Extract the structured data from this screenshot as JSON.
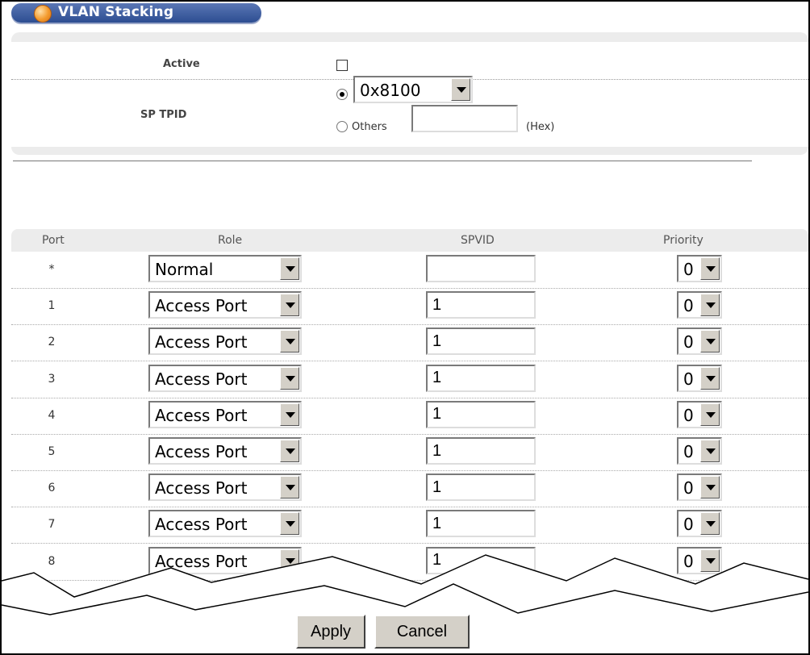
{
  "title": "VLAN Stacking",
  "settings": {
    "active_label": "Active",
    "active_checked": false,
    "sp_tpid_label": "SP TPID",
    "tpid_selected": "0x8100",
    "others_label": "Others",
    "others_value": "",
    "hex_label": "(Hex)"
  },
  "table": {
    "headers": {
      "port": "Port",
      "role": "Role",
      "spvid": "SPVID",
      "priority": "Priority"
    },
    "rows": [
      {
        "port": "*",
        "role": "Normal",
        "spvid": "",
        "priority": "0"
      },
      {
        "port": "1",
        "role": "Access Port",
        "spvid": "1",
        "priority": "0"
      },
      {
        "port": "2",
        "role": "Access Port",
        "spvid": "1",
        "priority": "0"
      },
      {
        "port": "3",
        "role": "Access Port",
        "spvid": "1",
        "priority": "0"
      },
      {
        "port": "4",
        "role": "Access Port",
        "spvid": "1",
        "priority": "0"
      },
      {
        "port": "5",
        "role": "Access Port",
        "spvid": "1",
        "priority": "0"
      },
      {
        "port": "6",
        "role": "Access Port",
        "spvid": "1",
        "priority": "0"
      },
      {
        "port": "7",
        "role": "Access Port",
        "spvid": "1",
        "priority": "0"
      },
      {
        "port": "8",
        "role": "Access Port",
        "spvid": "1",
        "priority": "0"
      }
    ]
  },
  "buttons": {
    "apply": "Apply",
    "cancel": "Cancel"
  },
  "colors": {
    "title_bar": "#2c4d91",
    "panel_bg": "#ececec",
    "button_face": "#d4d0c8"
  }
}
